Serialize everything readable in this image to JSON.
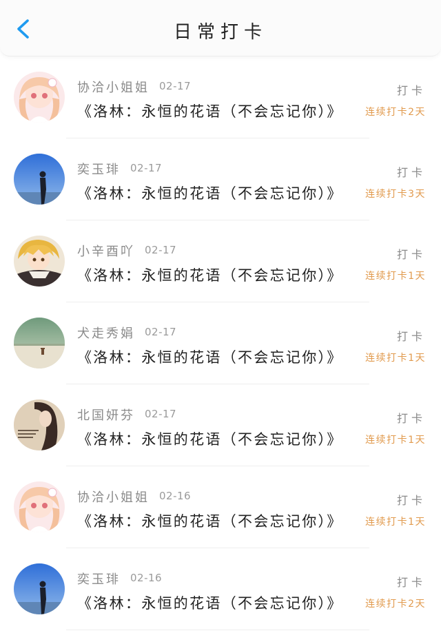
{
  "header": {
    "title": "日常打卡",
    "back_icon": "chevron-left-icon",
    "back_color": "#1f9bf0"
  },
  "colors": {
    "streak": "#e19a4d",
    "secondary_text": "#8a8a8a",
    "primary_text": "#222222"
  },
  "entries": [
    {
      "name": "协洽小姐姐",
      "date": "02-17",
      "book": "《洛林：永恒的花语（不会忘记你）》",
      "action": "打卡",
      "streak": "连续打卡2天",
      "avatar": "anime-girl-pink"
    },
    {
      "name": "奕玉琲",
      "date": "02-17",
      "book": "《洛林：永恒的花语（不会忘记你）》",
      "action": "打卡",
      "streak": "连续打卡3天",
      "avatar": "silhouette-blue-sky"
    },
    {
      "name": "小辛酉吖",
      "date": "02-17",
      "book": "《洛林：永恒的花语（不会忘记你）》",
      "action": "打卡",
      "streak": "连续打卡1天",
      "avatar": "anime-boy-blonde"
    },
    {
      "name": "犬走秀娟",
      "date": "02-17",
      "book": "《洛林：永恒的花语（不会忘记你）》",
      "action": "打卡",
      "streak": "连续打卡1天",
      "avatar": "landscape-field"
    },
    {
      "name": "北国妍芬",
      "date": "02-17",
      "book": "《洛林：永恒的花语（不会忘记你）》",
      "action": "打卡",
      "streak": "连续打卡1天",
      "avatar": "girl-photo-warm"
    },
    {
      "name": "协洽小姐姐",
      "date": "02-16",
      "book": "《洛林：永恒的花语（不会忘记你）》",
      "action": "打卡",
      "streak": "连续打卡1天",
      "avatar": "anime-girl-pink"
    },
    {
      "name": "奕玉琲",
      "date": "02-16",
      "book": "《洛林：永恒的花语（不会忘记你）》",
      "action": "打卡",
      "streak": "连续打卡2天",
      "avatar": "silhouette-blue-sky"
    }
  ]
}
